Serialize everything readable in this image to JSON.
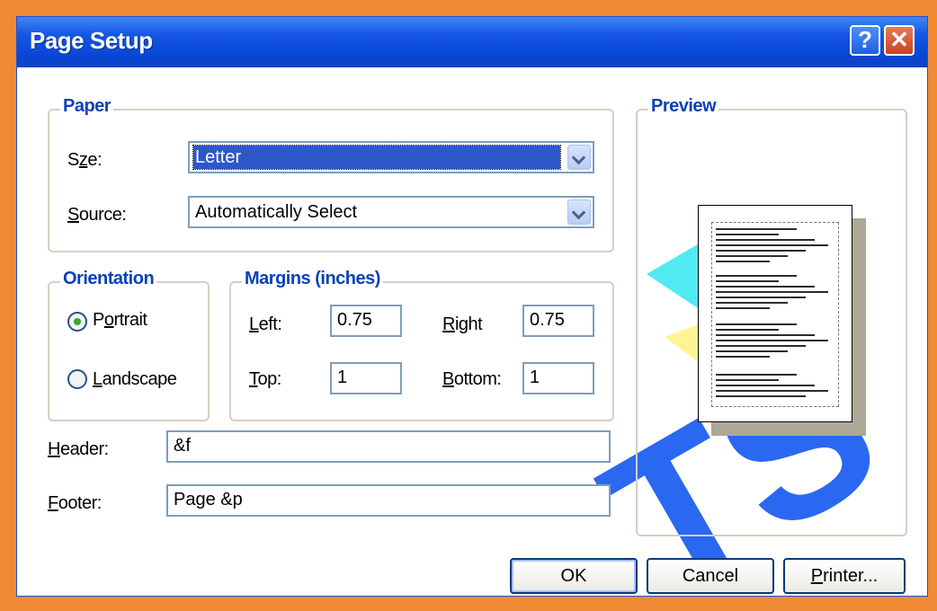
{
  "window": {
    "title": "Page Setup",
    "help_glyph": "?",
    "close_glyph": "✕"
  },
  "paper": {
    "group_label": "Paper",
    "size": {
      "label_pre": "S",
      "label_u": "z",
      "label_post": "e:",
      "value": "Letter"
    },
    "source": {
      "label_pre": "",
      "label_u": "S",
      "label_post": "ource:",
      "value": "Automatically Select"
    }
  },
  "orientation": {
    "group_label": "Orientation",
    "portrait": {
      "label_pre": "P",
      "label_u": "o",
      "label_post": "rtrait",
      "selected": true
    },
    "landscape": {
      "label_pre": "",
      "label_u": "L",
      "label_post": "andscape",
      "selected": false
    }
  },
  "margins": {
    "group_label": "Margins (inches)",
    "left": {
      "label_pre": "",
      "label_u": "L",
      "label_post": "eft:",
      "value": "0.75"
    },
    "right": {
      "label_pre": "",
      "label_u": "R",
      "label_post": "ight",
      "value": "0.75"
    },
    "top": {
      "label_pre": "",
      "label_u": "T",
      "label_post": "op:",
      "value": "1"
    },
    "bottom": {
      "label_pre": "",
      "label_u": "B",
      "label_post": "ottom:",
      "value": "1"
    }
  },
  "header": {
    "label_pre": "",
    "label_u": "H",
    "label_post": "eader:",
    "value": "&f"
  },
  "footer": {
    "label_pre": "",
    "label_u": "F",
    "label_post": "ooter:",
    "value": "Page &p"
  },
  "preview": {
    "group_label": "Preview"
  },
  "buttons": {
    "ok": "OK",
    "cancel": "Cancel",
    "printer_pre": "",
    "printer_u": "P",
    "printer_post": "rinter..."
  },
  "colors": {
    "frame": "#f08a33",
    "titlebar": "#0a47d7",
    "group_title": "#0a42b8",
    "selection": "#2d58c8"
  }
}
